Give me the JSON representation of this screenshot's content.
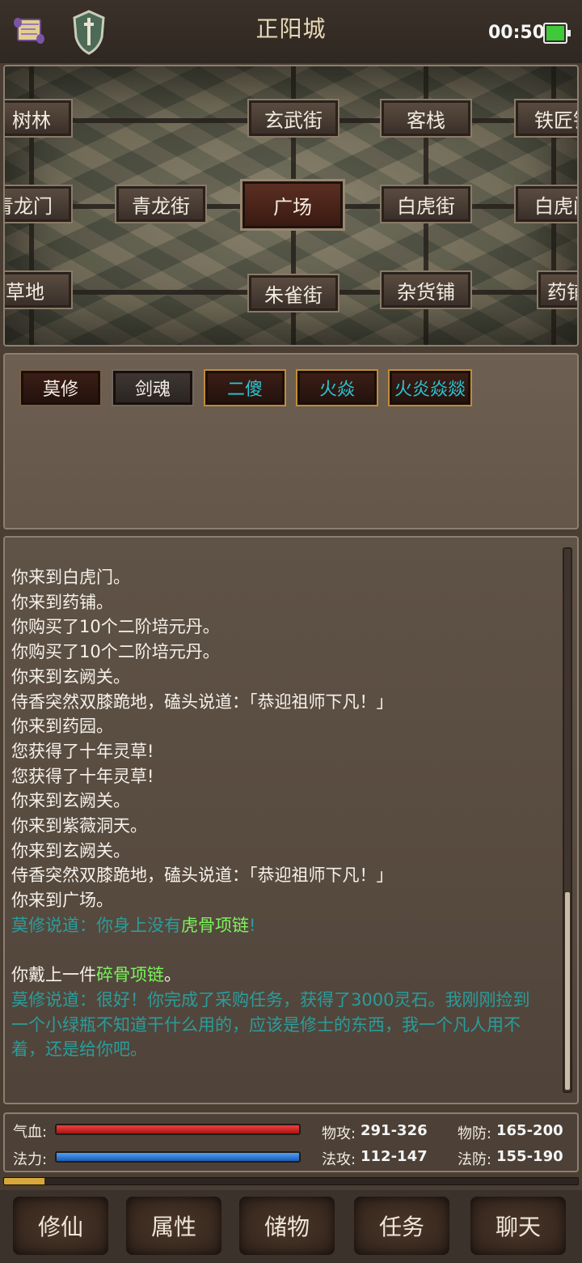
{
  "header": {
    "title": "正阳城",
    "clock": "00:50",
    "battery_level": 1.0
  },
  "map": {
    "locations": {
      "shulin": "树林",
      "xuanwu": "玄武街",
      "kezhan": "客栈",
      "tiejiang": "铁匠铺",
      "qinglongmen": "青龙门",
      "qinglongjie": "青龙街",
      "guangchang": "广场",
      "baihujie": "白虎街",
      "baihumen": "白虎门",
      "caodi": "草地",
      "zhuque": "朱雀街",
      "zahuo": "杂货铺",
      "yaopu": "药铺"
    },
    "current": "广场"
  },
  "npcs": [
    {
      "name": "莫修",
      "style": "normal"
    },
    {
      "name": "剑魂",
      "style": "gray"
    },
    {
      "name": "二傻",
      "style": "cyan"
    },
    {
      "name": "火焱",
      "style": "cyan"
    },
    {
      "name": "火炎焱燚",
      "style": "cyan"
    }
  ],
  "log": {
    "lines": [
      "你来到白虎门。",
      "你来到药铺。",
      "你购买了10个二阶培元丹。",
      "你购买了10个二阶培元丹。",
      "你来到玄阙关。",
      "侍香突然双膝跪地，磕头说道：「恭迎祖师下凡！」",
      "你来到药园。",
      "您获得了十年灵草!",
      "您获得了十年灵草!",
      "你来到玄阙关。",
      "你来到紫薇洞天。",
      "你来到玄阙关。",
      "侍香突然双膝跪地，磕头说道：「恭迎祖师下凡！」",
      "你来到广场。"
    ],
    "npc_line1_prefix": "莫修说道：你身上没有",
    "npc_line1_item": "虎骨项链",
    "npc_line1_suffix": "!",
    "equip_prefix": "你戴上一件",
    "equip_item": "碎骨项链",
    "equip_suffix": "。",
    "npc_line2_row1": "莫修说道：很好！你完成了采购任务，获得了3000灵石。我刚刚捡到",
    "npc_line2_row2": "一个小绿瓶不知道干什么用的，应该是修士的东西，我一个凡人用不",
    "npc_line2_row3": "着，还是给你吧。"
  },
  "stats": {
    "hp_label": "气血:",
    "mp_label": "法力:",
    "hp_fraction": 1.0,
    "mp_fraction": 1.0,
    "patk_label": "物攻:",
    "patk": "291-326",
    "pdef_label": "物防:",
    "pdef": "165-200",
    "matk_label": "法攻:",
    "matk": "112-147",
    "mdef_label": "法防:",
    "mdef": "155-190",
    "exp_fraction": 0.07
  },
  "nav": {
    "cultivate": "修仙",
    "attributes": "属性",
    "storage": "储物",
    "quests": "任务",
    "chat": "聊天"
  },
  "colors": {
    "npc_speech": "#2a9d9b",
    "item_highlight": "#7cf45c",
    "hp_bar": "#e03030",
    "mp_bar": "#3a86e0"
  }
}
